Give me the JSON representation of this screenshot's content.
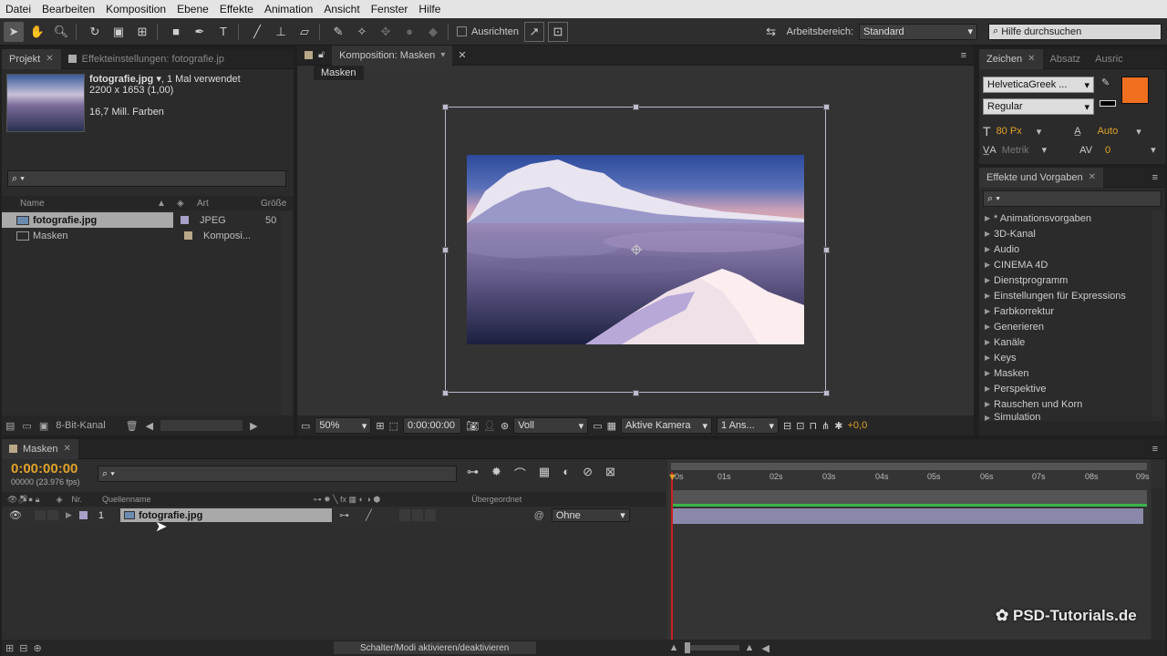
{
  "menu": [
    "Datei",
    "Bearbeiten",
    "Komposition",
    "Ebene",
    "Effekte",
    "Animation",
    "Ansicht",
    "Fenster",
    "Hilfe"
  ],
  "toolbar": {
    "ausrichten": "Ausrichten",
    "workspace_label": "Arbeitsbereich:",
    "workspace_value": "Standard",
    "help_search": "Hilfe durchsuchen"
  },
  "project": {
    "tab": "Projekt",
    "effect_tab": "Effekteinstellungen: fotografie.jp",
    "file_name": "fotografie.jpg",
    "usage": ", 1 Mal verwendet",
    "dimensions": "2200 x 1653 (1,00)",
    "colors": "16,7 Mill. Farben",
    "col_name": "Name",
    "col_type": "Art",
    "col_size": "Größe",
    "items": [
      {
        "name": "fotografie.jpg",
        "type": "JPEG",
        "size": "50",
        "swatch": "#a8a0c8"
      },
      {
        "name": "Masken",
        "type": "Komposi...",
        "size": "",
        "swatch": "#b8a888"
      }
    ],
    "bit_depth": "8-Bit-Kanal"
  },
  "comp": {
    "tab": "Komposition: Masken",
    "breadcrumb": "Masken",
    "zoom": "50%",
    "timecode": "0:00:00:00",
    "resolution": "Voll",
    "camera": "Aktive Kamera",
    "views": "1 Ans...",
    "exposure": "+0,0"
  },
  "character": {
    "tab": "Zeichen",
    "tab2": "Absatz",
    "tab3": "Ausric",
    "font": "HelveticaGreek ...",
    "style": "Regular",
    "size": "80 Px",
    "leading": "Auto",
    "kerning": "Metrik",
    "tracking": "0",
    "fill_color": "#f07020"
  },
  "effects": {
    "tab": "Effekte und Vorgaben",
    "items": [
      "* Animationsvorgaben",
      "3D-Kanal",
      "Audio",
      "CINEMA 4D",
      "Dienstprogramm",
      "Einstellungen für Expressions",
      "Farbkorrektur",
      "Generieren",
      "Kanäle",
      "Keys",
      "Masken",
      "Perspektive",
      "Rauschen und Korn",
      "Simulation"
    ]
  },
  "timeline": {
    "tab": "Masken",
    "timecode": "0:00:00:00",
    "fps": "00000 (23.976 fps)",
    "col_nr": "Nr.",
    "col_source": "Quellenname",
    "col_parent": "Übergeordnet",
    "layer_nr": "1",
    "layer_name": "fotografie.jpg",
    "parent_value": "Ohne",
    "ruler": [
      "0s",
      "01s",
      "02s",
      "03s",
      "04s",
      "05s",
      "06s",
      "07s",
      "08s",
      "09s"
    ],
    "toggle_label": "Schalter/Modi aktivieren/deaktivieren"
  },
  "watermark": "PSD-Tutorials.de"
}
